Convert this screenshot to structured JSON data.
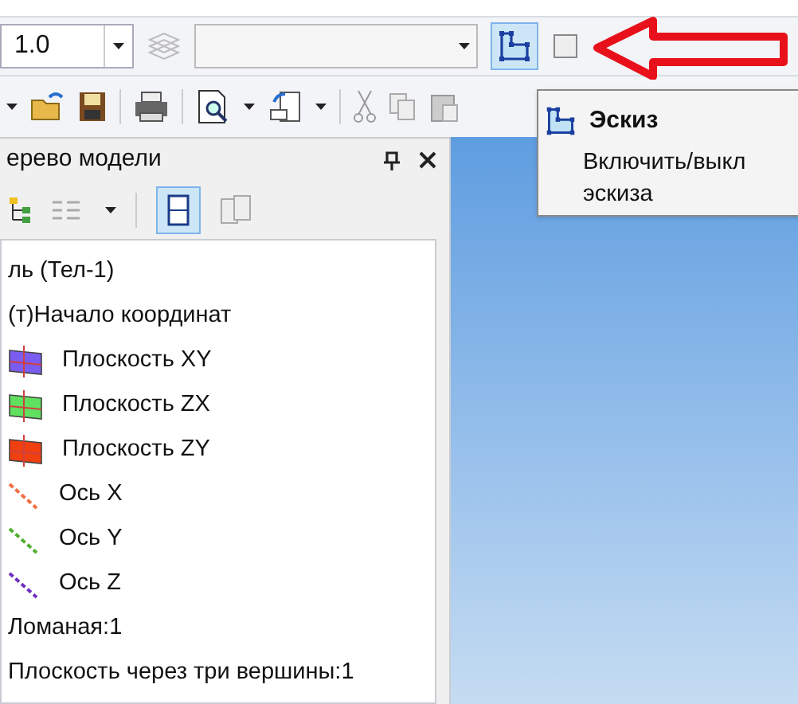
{
  "toolbar_top": {
    "scale_combo": {
      "value": "1.0"
    },
    "sketch_button": {
      "selected": true
    }
  },
  "tooltip": {
    "title": "Эскиз",
    "text_line_1": "Включить/выкл",
    "text_line_2": "эскиза"
  },
  "model_tree": {
    "title": "ерево модели",
    "items": [
      {
        "kind": "text",
        "label": "ль (Тел-1)"
      },
      {
        "kind": "text",
        "label": "(т)Начало координат"
      },
      {
        "kind": "plane",
        "label": "Плоскость XY",
        "color": "#7b5cf0"
      },
      {
        "kind": "plane",
        "label": "Плоскость ZX",
        "color": "#5fe05f"
      },
      {
        "kind": "plane",
        "label": "Плоскость ZY",
        "color": "#f04010"
      },
      {
        "kind": "axis",
        "label": "Ось X",
        "color": "#f07040"
      },
      {
        "kind": "axis",
        "label": "Ось Y",
        "color": "#50b030"
      },
      {
        "kind": "axis",
        "label": "Ось Z",
        "color": "#7030c0"
      },
      {
        "kind": "text",
        "label": "Ломаная:1"
      },
      {
        "kind": "text",
        "label": "Плоскость через три вершины:1"
      }
    ]
  }
}
